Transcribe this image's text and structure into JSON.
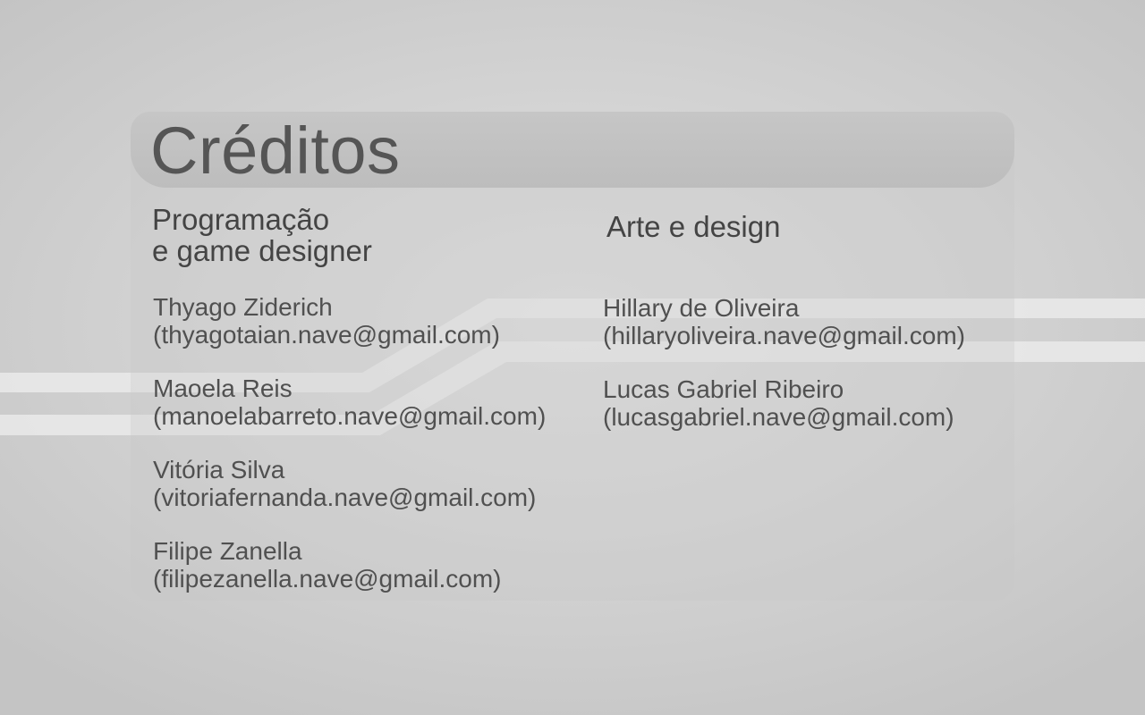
{
  "title": "Créditos",
  "sections": [
    {
      "heading_line1": "Programação",
      "heading_line2": "e game designer",
      "people": [
        {
          "name": "Thyago Ziderich",
          "email": "(thyagotaian.nave@gmail.com)"
        },
        {
          "name": "Maoela Reis",
          "email": "(manoelabarreto.nave@gmail.com)"
        },
        {
          "name": "Vitória Silva",
          "email": "(vitoriafernanda.nave@gmail.com)"
        },
        {
          "name": "Filipe Zanella",
          "email": "(filipezanella.nave@gmail.com)"
        }
      ]
    },
    {
      "heading_line1": "Arte e design",
      "people": [
        {
          "name": "Hillary de Oliveira",
          "email": "(hillaryoliveira.nave@gmail.com)"
        },
        {
          "name": "Lucas Gabriel Ribeiro",
          "email": "(lucasgabriel.nave@gmail.com)"
        }
      ]
    }
  ],
  "colors": {
    "background": "#d6d6d6",
    "title_bar": "#c2c2c2",
    "text": "#4a4a4a",
    "stripe": "#ececec"
  }
}
